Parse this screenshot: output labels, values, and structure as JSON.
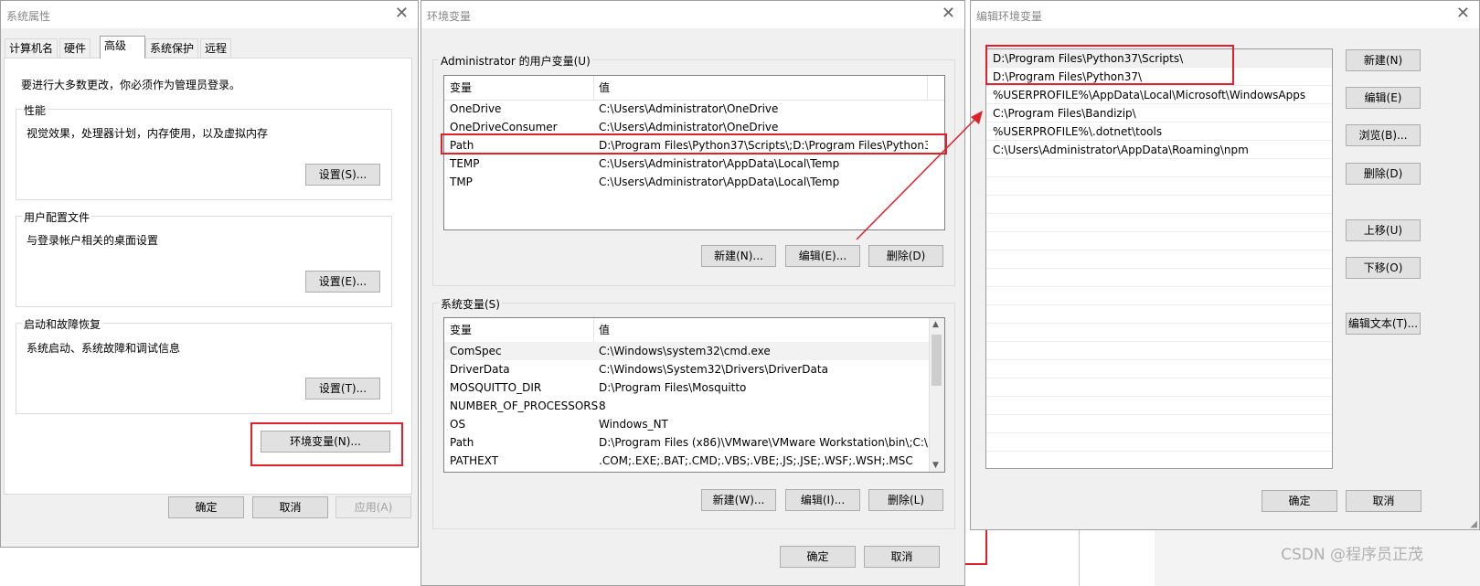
{
  "colors": {
    "highlight": "#e0212b",
    "window_bg": "#f0f0f0"
  },
  "sysprops": {
    "title": "系统属性",
    "tabs": [
      "计算机名",
      "硬件",
      "高级",
      "系统保护",
      "远程"
    ],
    "notice": "要进行大多数更改，你必须作为管理员登录。",
    "perf": {
      "title": "性能",
      "desc": "视觉效果，处理器计划，内存使用，以及虚拟内存",
      "button": "设置(S)..."
    },
    "profile": {
      "title": "用户配置文件",
      "desc": "与登录帐户相关的桌面设置",
      "button": "设置(E)..."
    },
    "startup": {
      "title": "启动和故障恢复",
      "desc": "系统启动、系统故障和调试信息",
      "button": "设置(T)..."
    },
    "env_button": "环境变量(N)...",
    "ok": "确定",
    "cancel": "取消",
    "apply": "应用(A)"
  },
  "envvars": {
    "title": "环境变量",
    "user_group": "Administrator 的用户变量(U)",
    "col_var": "变量",
    "col_val": "值",
    "user_rows": [
      {
        "name": "OneDrive",
        "value": "C:\\Users\\Administrator\\OneDrive"
      },
      {
        "name": "OneDriveConsumer",
        "value": "C:\\Users\\Administrator\\OneDrive"
      },
      {
        "name": "Path",
        "value": "D:\\Program Files\\Python37\\Scripts\\;D:\\Program Files\\Python3..."
      },
      {
        "name": "TEMP",
        "value": "C:\\Users\\Administrator\\AppData\\Local\\Temp"
      },
      {
        "name": "TMP",
        "value": "C:\\Users\\Administrator\\AppData\\Local\\Temp"
      }
    ],
    "user_buttons": {
      "new": "新建(N)...",
      "edit": "编辑(E)...",
      "delete": "删除(D)"
    },
    "sys_group": "系统变量(S)",
    "sys_rows": [
      {
        "name": "ComSpec",
        "value": "C:\\Windows\\system32\\cmd.exe"
      },
      {
        "name": "DriverData",
        "value": "C:\\Windows\\System32\\Drivers\\DriverData"
      },
      {
        "name": "MOSQUITTO_DIR",
        "value": "D:\\Program Files\\Mosquitto"
      },
      {
        "name": "NUMBER_OF_PROCESSORS",
        "value": "8"
      },
      {
        "name": "OS",
        "value": "Windows_NT"
      },
      {
        "name": "Path",
        "value": "D:\\Program Files (x86)\\VMware\\VMware Workstation\\bin\\;C:\\..."
      },
      {
        "name": "PATHEXT",
        "value": ".COM;.EXE;.BAT;.CMD;.VBS;.VBE;.JS;.JSE;.WSF;.WSH;.MSC"
      }
    ],
    "sys_buttons": {
      "new": "新建(W)...",
      "edit": "编辑(I)...",
      "delete": "删除(L)"
    },
    "ok": "确定",
    "cancel": "取消"
  },
  "editenv": {
    "title": "编辑环境变量",
    "entries": [
      "D:\\Program Files\\Python37\\Scripts\\",
      "D:\\Program Files\\Python37\\",
      "%USERPROFILE%\\AppData\\Local\\Microsoft\\WindowsApps",
      "C:\\Program Files\\Bandizip\\",
      "%USERPROFILE%\\.dotnet\\tools",
      "C:\\Users\\Administrator\\AppData\\Roaming\\npm"
    ],
    "buttons": {
      "new": "新建(N)",
      "edit": "编辑(E)",
      "browse": "浏览(B)...",
      "delete": "删除(D)",
      "up": "上移(U)",
      "down": "下移(O)",
      "edit_text": "编辑文本(T)..."
    },
    "ok": "确定",
    "cancel": "取消"
  },
  "watermark": "CSDN @程序员正茂"
}
